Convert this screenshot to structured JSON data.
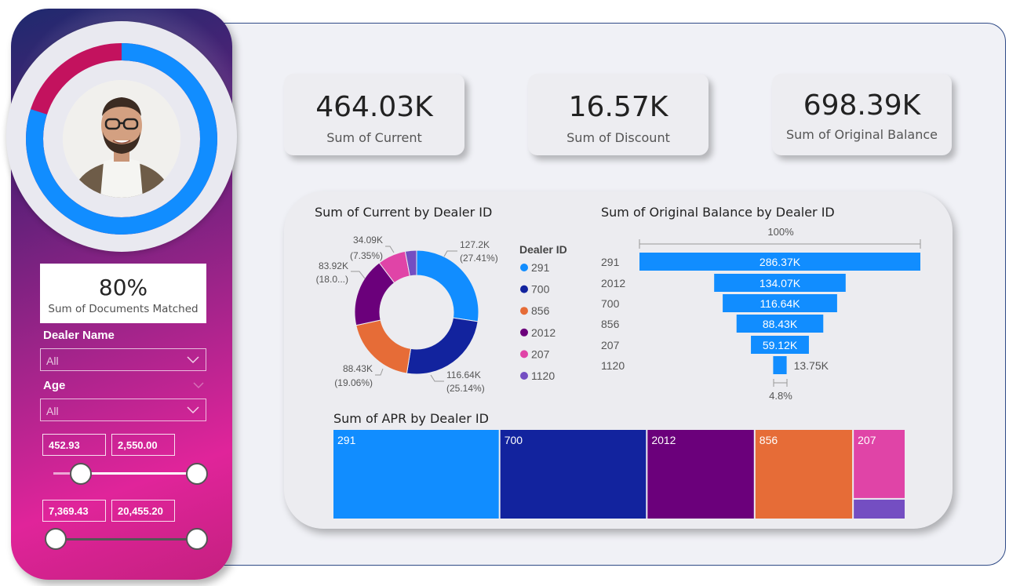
{
  "sidebar": {
    "documents_kpi": {
      "value": "80%",
      "label": "Sum of Documents Matched",
      "ring_fraction": 0.8
    },
    "dealer_name": {
      "label": "Dealer Name",
      "value": "All"
    },
    "age": {
      "label": "Age",
      "value": "All"
    },
    "range1": {
      "min": "452.93",
      "max": "2,550.00"
    },
    "range2": {
      "min": "7,369.43",
      "max": "20,455.20"
    }
  },
  "kpis": [
    {
      "value": "464.03K",
      "label": "Sum of Current"
    },
    {
      "value": "16.57K",
      "label": "Sum of Discount"
    },
    {
      "value": "698.39K",
      "label": "Sum of Original Balance"
    }
  ],
  "colors": {
    "291": "#118dff",
    "700": "#12239e",
    "856": "#e66c37",
    "2012": "#6b007b",
    "207": "#e044a7",
    "1120": "#744ec2"
  },
  "chart_data": [
    {
      "type": "pie",
      "title": "Sum of Current by Dealer ID",
      "legend_title": "Dealer ID",
      "legend_position": "right",
      "categories": [
        "291",
        "700",
        "856",
        "2012",
        "207",
        "1120"
      ],
      "values": [
        127.2,
        116.64,
        88.43,
        83.92,
        34.09,
        13.75
      ],
      "data_labels": [
        [
          "127.2K",
          "(27.41%)"
        ],
        [
          "116.64K",
          "(25.14%)"
        ],
        [
          "88.43K",
          "(19.06%)"
        ],
        [
          "83.92K",
          "(18.0...)"
        ],
        [
          "34.09K",
          "(7.35%)"
        ]
      ]
    },
    {
      "type": "bar",
      "subtype": "funnel",
      "title": "Sum of Original Balance by Dealer ID",
      "categories": [
        "291",
        "2012",
        "700",
        "856",
        "207",
        "1120"
      ],
      "values": [
        286.37,
        134.07,
        116.64,
        88.43,
        59.12,
        13.75
      ],
      "value_labels": [
        "286.37K",
        "134.07K",
        "116.64K",
        "88.43K",
        "59.12K",
        "13.75K"
      ],
      "top_pct": "100%",
      "bottom_pct": "4.8%"
    },
    {
      "type": "heatmap",
      "subtype": "treemap",
      "title": "Sum of APR by Dealer ID",
      "categories": [
        "291",
        "700",
        "2012",
        "856",
        "207",
        "1120"
      ],
      "values": [
        24.6,
        21.7,
        15.9,
        14.5,
        5.9,
        1.6
      ]
    }
  ]
}
